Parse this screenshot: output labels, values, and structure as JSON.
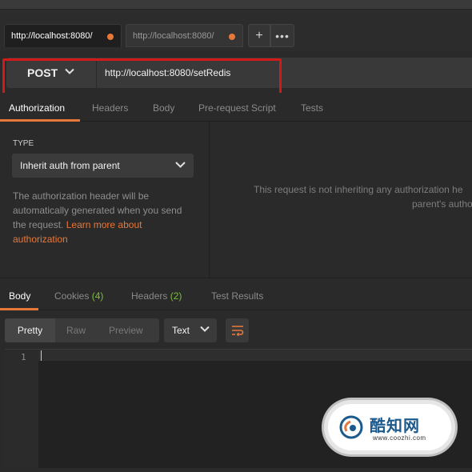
{
  "tabs": [
    {
      "label": "http://localhost:8080/"
    },
    {
      "label": "http://localhost:8080/"
    }
  ],
  "tab_actions": {
    "add": "+",
    "more": "•••"
  },
  "request": {
    "method": "POST",
    "url": "http://localhost:8080/setRedis"
  },
  "request_tabs": [
    "Authorization",
    "Headers",
    "Body",
    "Pre-request Script",
    "Tests"
  ],
  "auth": {
    "type_label": "TYPE",
    "selected": "Inherit auth from parent",
    "desc_line1": "The authorization header will be",
    "desc_line2": "automatically generated when you send",
    "desc_line3": "the request.",
    "link_part1": "Learn more about",
    "link_part2": "authorization",
    "inherit_line1": "This request is not inheriting any authorization he",
    "inherit_line2": "parent's autho"
  },
  "response_tabs": {
    "body": "Body",
    "cookies": "Cookies",
    "cookies_count": "(4)",
    "headers": "Headers",
    "headers_count": "(2)",
    "test_results": "Test Results"
  },
  "view_modes": {
    "pretty": "Pretty",
    "raw": "Raw",
    "preview": "Preview"
  },
  "format": "Text",
  "editor": {
    "line_number": "1"
  },
  "watermark": {
    "name": "酷知网",
    "url": "www.coozhi.com"
  },
  "colors": {
    "accent": "#e8773a",
    "highlight": "#d21a1a",
    "count": "#7bbf3a"
  }
}
